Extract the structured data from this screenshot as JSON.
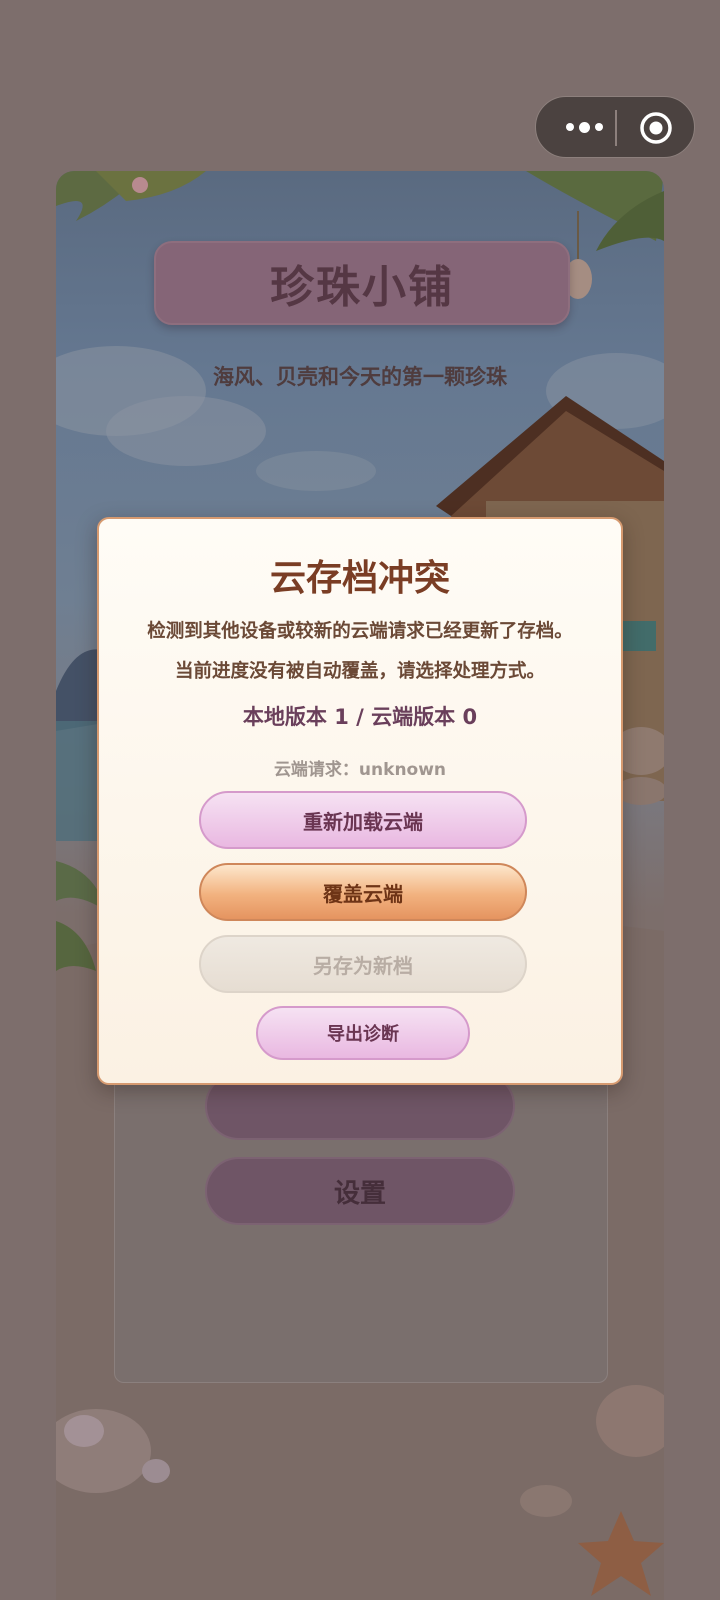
{
  "capsule": {
    "more_icon": "more-dots-icon",
    "close_icon": "target-circle-icon"
  },
  "game": {
    "title": "珍珠小铺",
    "subtitle": "海风、贝壳和今天的第一颗珍珠",
    "menu": {
      "settings_label": "设置"
    }
  },
  "dialog": {
    "title": "云存档冲突",
    "message_line1": "检测到其他设备或较新的云端请求已经更新了存档。",
    "message_line2": "当前进度没有被自动覆盖，请选择处理方式。",
    "versions": "本地版本 1 / 云端版本 0",
    "cloud_request": "云端请求：unknown",
    "buttons": {
      "reload_cloud": "重新加载云端",
      "overwrite_cloud": "覆盖云端",
      "save_as_new": "另存为新档",
      "export_diagnostics": "导出诊断"
    }
  },
  "colors": {
    "overlay": "#7d6e6c",
    "dialog_border": "#d69a70",
    "title_color": "#7a3d24",
    "pink_button": "#e9b8e1",
    "orange_button": "#f2b27f"
  }
}
